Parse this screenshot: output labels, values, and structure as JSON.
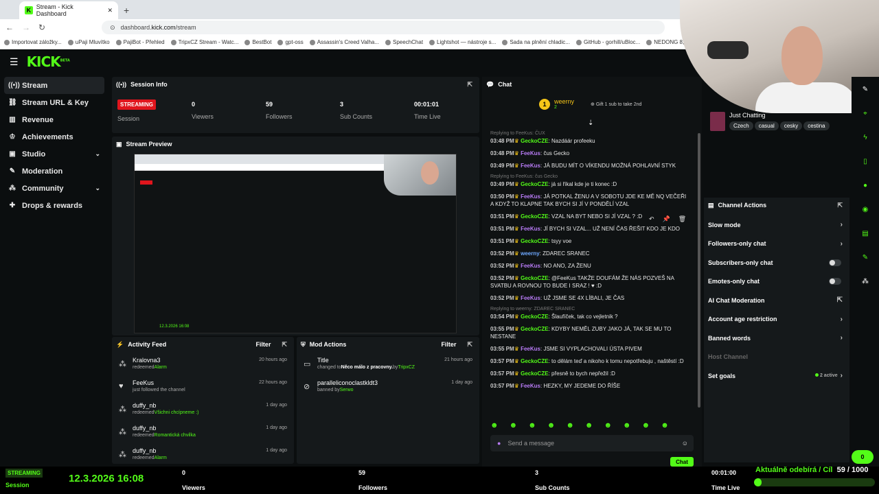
{
  "browser": {
    "tab_title": "Stream - Kick Dashboard",
    "url_prefix": "dashboard.",
    "url_domain": "kick.com",
    "url_path": "/stream",
    "bookmarks": [
      "Importovat záložky...",
      "uPaji Mluvítko",
      "PajiBot - Přehled",
      "TripxCZ Stream - Watc...",
      "BestBot",
      "gpt-oss",
      "Assassin's Creed Valha...",
      "SpeechChat",
      "Lightshot — nástroje s...",
      "Sada na plnění chladic...",
      "GitHub - gorhill/uBloc...",
      "NEDONG 8,5x2 Bezdu..."
    ]
  },
  "app": {
    "logo": "KICK",
    "logo_sup": "BETA"
  },
  "sidebar": {
    "items": [
      {
        "label": "Stream",
        "icon": "broadcast-icon"
      },
      {
        "label": "Stream URL & Key",
        "icon": "link-icon"
      },
      {
        "label": "Revenue",
        "icon": "chart-icon"
      },
      {
        "label": "Achievements",
        "icon": "trophy-icon"
      },
      {
        "label": "Studio",
        "icon": "camera-icon"
      },
      {
        "label": "Moderation",
        "icon": "wrench-icon"
      },
      {
        "label": "Community",
        "icon": "people-icon"
      },
      {
        "label": "Drops & rewards",
        "icon": "gift-icon"
      }
    ]
  },
  "session": {
    "title": "Session Info",
    "badge": "STREAMING",
    "badge_label": "Session",
    "stats": [
      {
        "value": "0",
        "label": "Viewers"
      },
      {
        "value": "59",
        "label": "Followers"
      },
      {
        "value": "3",
        "label": "Sub Counts"
      },
      {
        "value": "00:01:01",
        "label": "Time Live"
      }
    ]
  },
  "preview": {
    "title": "Stream Preview",
    "overlay_date": "12.3.2026 16:08"
  },
  "activity": {
    "title": "Activity Feed",
    "filter": "Filter",
    "items": [
      {
        "name": "Kralovna3",
        "action": "redeemed",
        "reward": "Alarm",
        "time": "20 hours ago",
        "icon": "redeem-icon"
      },
      {
        "name": "FeeKus",
        "action": "just followed the channel",
        "reward": "",
        "time": "22 hours ago",
        "icon": "heart-icon"
      },
      {
        "name": "duffy_nb",
        "action": "redeemed",
        "reward": "Všichni chcípneme :)",
        "time": "1 day ago",
        "icon": "redeem-icon"
      },
      {
        "name": "duffy_nb",
        "action": "redeemed",
        "reward": "Romantická chvilka",
        "time": "1 day ago",
        "icon": "redeem-icon"
      },
      {
        "name": "duffy_nb",
        "action": "redeemed",
        "reward": "Alarm",
        "time": "1 day ago",
        "icon": "redeem-icon"
      }
    ]
  },
  "mod": {
    "title": "Mod Actions",
    "filter": "Filter",
    "items": [
      {
        "name": "Title",
        "pre": "changed to",
        "detail": "Něco málo z pracovny.",
        "by": "by",
        "user": "TripxCZ",
        "time": "21 hours ago"
      },
      {
        "name": "paralleliconoclastkldt3",
        "pre": "banned by",
        "detail": "",
        "by": "",
        "user": "Serwo",
        "time": "1 day ago"
      }
    ]
  },
  "chat": {
    "title": "Chat",
    "pinned_user": "weerny",
    "pinned_count": "2",
    "gift_text": "Gift 1 sub to take 2nd",
    "messages": [
      {
        "reply": "Replying to FeeKus: ČUX",
        "time": "03:48 PM",
        "user": "GeckoCZE",
        "cls": "u2",
        "text": ": Nazdáár profeeku"
      },
      {
        "reply": "",
        "time": "03:48 PM",
        "user": "FeeKus",
        "cls": "u1",
        "text": ": čus Gecko"
      },
      {
        "reply": "",
        "time": "03:49 PM",
        "user": "FeeKus",
        "cls": "u1",
        "text": ": JÁ BUDU MÍT O VÍKENDU MOŽNÁ POHLAVNÍ STYK"
      },
      {
        "reply": "Replying to FeeKus: čus Gecko",
        "time": "03:49 PM",
        "user": "GeckoCZE",
        "cls": "u2",
        "text": ": já si říkal kde je ti konec :D"
      },
      {
        "reply": "",
        "time": "03:50 PM",
        "user": "FeeKus",
        "cls": "u1",
        "text": ": JÁ POTKAL ŽENU A V SOBOTU JDE KE MĚ NQ VEČEŘI A KDYŽ TO KLAPNE TAK BYCH SI JÍ V PONDĚLÍ VZAL"
      },
      {
        "reply": "",
        "time": "03:51 PM",
        "user": "GeckoCZE",
        "cls": "u2",
        "text": ": VZAL NA BYT NEBO SI JÍ VZAL ? :D"
      },
      {
        "reply": "",
        "time": "03:51 PM",
        "user": "FeeKus",
        "cls": "u1",
        "text": ": JÍ BYCH SI VZAL... UŽ NENÍ ČAS ŘEŠIT KDO JE KDO"
      },
      {
        "reply": "",
        "time": "03:51 PM",
        "user": "GeckoCZE",
        "cls": "u2",
        "text": ": tsyy voe"
      },
      {
        "reply": "",
        "time": "03:52 PM",
        "user": "weerny",
        "cls": "u3",
        "text": ": ZDAREC SRANEC"
      },
      {
        "reply": "",
        "time": "03:52 PM",
        "user": "FeeKus",
        "cls": "u1",
        "text": ": NO ANO, ZA ŽENU"
      },
      {
        "reply": "",
        "time": "03:52 PM",
        "user": "GeckoCZE",
        "cls": "u2",
        "text": ": @FeeKus TAKŽE DOUFÁM ŽE NÁS POZVEŠ NA SVATBU A ROVNOU TO BUDE I SRAZ ! ♥ :D"
      },
      {
        "reply": "",
        "time": "03:52 PM",
        "user": "FeeKus",
        "cls": "u1",
        "text": ": UŽ JSME SE 4X LÍBALI, JE ČAS"
      },
      {
        "reply": "Replying to weerny: ZDAREC SRANEC",
        "time": "03:54 PM",
        "user": "GeckoCZE",
        "cls": "u2",
        "text": ": Šlaufíček, tak co vejletnik ?"
      },
      {
        "reply": "",
        "time": "03:55 PM",
        "user": "GeckoCZE",
        "cls": "u2",
        "text": ": KDYBY NEMĚL ZUBY JAKO JÁ, TAK SE MU TO NESTANE"
      },
      {
        "reply": "",
        "time": "03:55 PM",
        "user": "FeeKus",
        "cls": "u1",
        "text": ": JSME SI VYPLACHOVALI ÚSTA PIVEM"
      },
      {
        "reply": "",
        "time": "03:57 PM",
        "user": "GeckoCZE",
        "cls": "u2",
        "text": ": to dělám teď a nikoho k tomu nepotřebuju , naštěstí :D"
      },
      {
        "reply": "",
        "time": "03:57 PM",
        "user": "GeckoCZE",
        "cls": "u2",
        "text": ": přesně to bych nepřežil :D"
      },
      {
        "reply": "",
        "time": "03:57 PM",
        "user": "FeeKus",
        "cls": "u1",
        "text": ": HEZKY, MY JEDEME DO ŘÍŠE"
      }
    ],
    "send_placeholder": "Send a message",
    "send_button": "Chat"
  },
  "category": {
    "name": "Just Chatting",
    "tags": [
      "Czech",
      "casual",
      "cesky",
      "cestina"
    ]
  },
  "channel_actions": {
    "title": "Channel Actions",
    "rows": [
      {
        "label": "Slow mode",
        "type": "chevron"
      },
      {
        "label": "Followers-only chat",
        "type": "chevron"
      },
      {
        "label": "Subscribers-only chat",
        "type": "toggle"
      },
      {
        "label": "Emotes-only chat",
        "type": "toggle"
      },
      {
        "label": "AI Chat Moderation",
        "type": "external"
      },
      {
        "label": "Account age restriction",
        "type": "chevron"
      },
      {
        "label": "Banned words",
        "type": "chevron"
      },
      {
        "label": "Host Channel",
        "type": "muted"
      },
      {
        "label": "Set goals",
        "type": "goals",
        "extra": "2 active"
      }
    ]
  },
  "bottombar": {
    "badge": "STREAMING",
    "session": "Session",
    "date": "12.3.2026 16:08",
    "viewers_value": "0",
    "viewers_label": "Viewers",
    "followers_value": "59",
    "followers_label": "Followers",
    "subs_value": "3",
    "subs_label": "Sub Counts",
    "time_value": "00:01:00",
    "time_label": "Time Live",
    "goal_text": "Aktuálně odebírá / Cíl",
    "goal_value": "59 / 1000",
    "goal_progress": 0.059
  },
  "rail_badge": "0",
  "colors": {
    "accent": "#53fc18",
    "live": "#e0151d",
    "bg": "#0b0e0f",
    "panel": "#15191b"
  }
}
